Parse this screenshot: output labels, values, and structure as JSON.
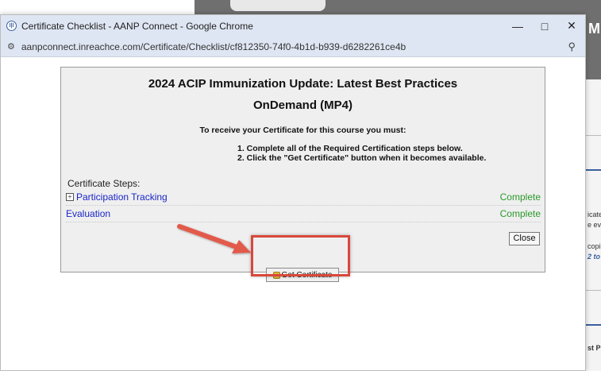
{
  "background": {
    "letter": "M",
    "snippets": [
      "icate",
      "e ev",
      "copi",
      "2 to",
      "st P"
    ]
  },
  "window": {
    "title": "Certificate Checklist - AANP Connect - Google Chrome",
    "url": "aanpconnect.inreachce.com/Certificate/Checklist/cf812350-74f0-4b1d-b939-d6282261ce4b",
    "favicon_label": "I|I"
  },
  "certificate": {
    "course_title_line1": "2024 ACIP Immunization Update: Latest Best Practices",
    "course_title_line2": "OnDemand (MP4)",
    "instructions": "To receive your Certificate for this course you must:",
    "requirement_1": "1. Complete all of the Required Certification steps below.",
    "requirement_2": "2. Click the \"Get Certificate\" button when it becomes available.",
    "steps_label": "Certificate Steps:",
    "steps": [
      {
        "name": "Participation Tracking",
        "status": "Complete"
      },
      {
        "name": "Evaluation",
        "status": "Complete"
      }
    ],
    "close_label": "Close",
    "get_certificate_label": "Get Certificate"
  },
  "colors": {
    "highlight": "#d9483b",
    "link": "#1a25c8",
    "status_complete": "#2a9a2a"
  }
}
